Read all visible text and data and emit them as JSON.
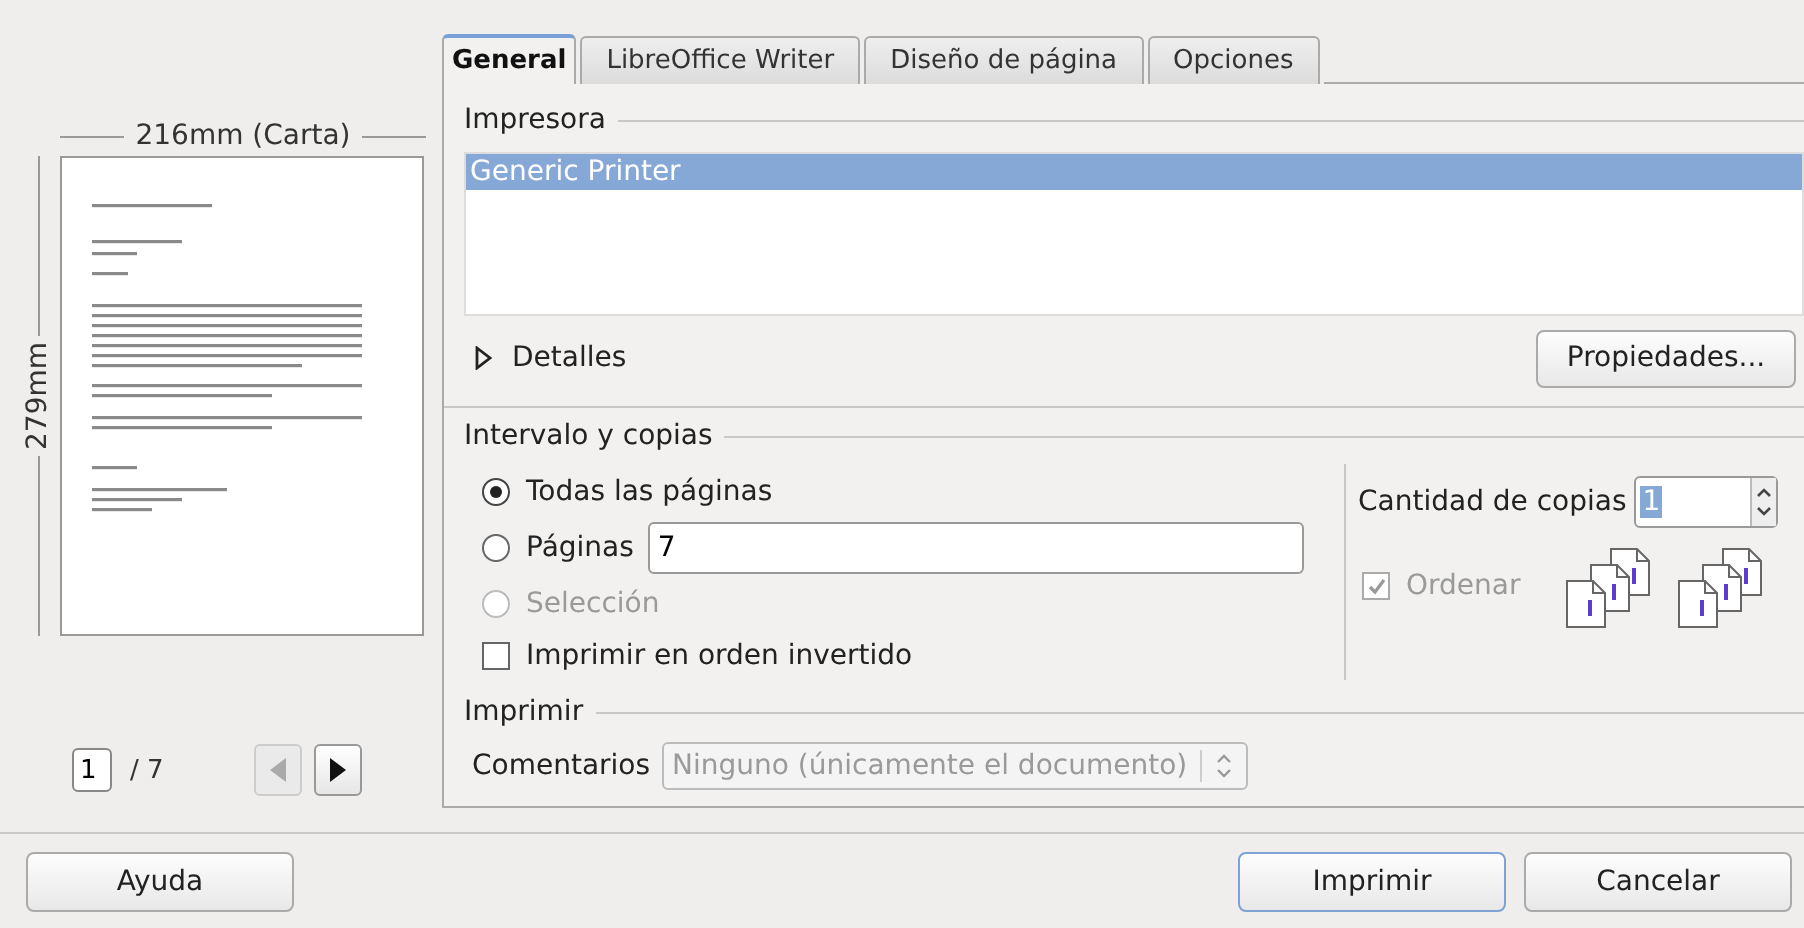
{
  "preview": {
    "width_label": "216mm (Carta)",
    "height_label": "279mm",
    "page_field": "1",
    "page_count": "/ 7",
    "prev_disabled": true,
    "next_disabled": false
  },
  "tabs": [
    {
      "label": "General",
      "selected": true
    },
    {
      "label": "LibreOffice Writer",
      "selected": false
    },
    {
      "label": "Diseño de página",
      "selected": false
    },
    {
      "label": "Opciones",
      "selected": false
    }
  ],
  "printer": {
    "title": "Impresora",
    "printers": [
      {
        "name": "Generic Printer",
        "selected": true
      }
    ],
    "details": {
      "label": "Detalles",
      "expanded": false
    },
    "properties_button": "Propiedades..."
  },
  "range": {
    "title": "Intervalo y copias",
    "options": [
      {
        "kind": "radio",
        "label": "Todas las páginas",
        "selected": true,
        "disabled": false
      },
      {
        "kind": "radio-field",
        "label": "Páginas",
        "value": "7",
        "selected": false,
        "disabled": false
      },
      {
        "kind": "radio",
        "label": "Selección",
        "selected": false,
        "disabled": true
      }
    ],
    "reverse": {
      "label": "Imprimir en orden invertido",
      "checked": false
    }
  },
  "copies": {
    "label": "Cantidad de copias",
    "value": "1",
    "collate": {
      "label": "Ordenar",
      "checked": true,
      "disabled": true
    }
  },
  "print": {
    "title": "Imprimir",
    "comments": {
      "label": "Comentarios",
      "value": "Ninguno (únicamente el documento)",
      "disabled": true
    }
  },
  "buttons": [
    {
      "label": "Ayuda",
      "default": false
    },
    {
      "label": "Imprimir",
      "default": true
    },
    {
      "label": "Cancelar",
      "default": false
    }
  ]
}
